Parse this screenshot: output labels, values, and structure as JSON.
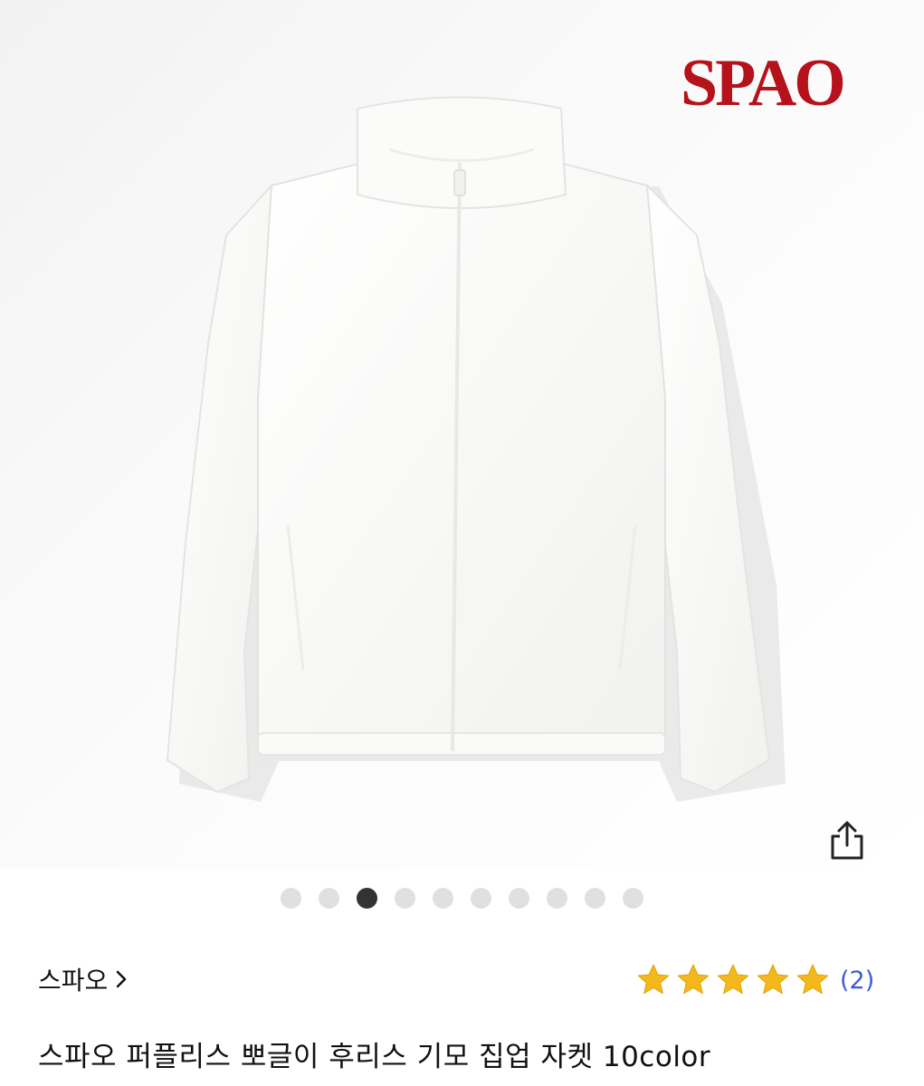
{
  "brand_logo": "SPAO",
  "gallery": {
    "total_images": 10,
    "active_index": 2
  },
  "product": {
    "brand_link": "스파오",
    "rating_stars": 5,
    "review_count": "(2)",
    "title": "스파오 퍼플리스 뽀글이 후리스 기모 집업 자켓 10color"
  },
  "colors": {
    "logo_red": "#b5121b",
    "star_gold": "#f5b81c",
    "link_blue": "#3b5bdb",
    "dot_active": "#333333",
    "dot_inactive": "#e0e0e0"
  },
  "icons": {
    "share": "share-icon",
    "chevron": "chevron-right-icon",
    "star": "star-icon"
  }
}
